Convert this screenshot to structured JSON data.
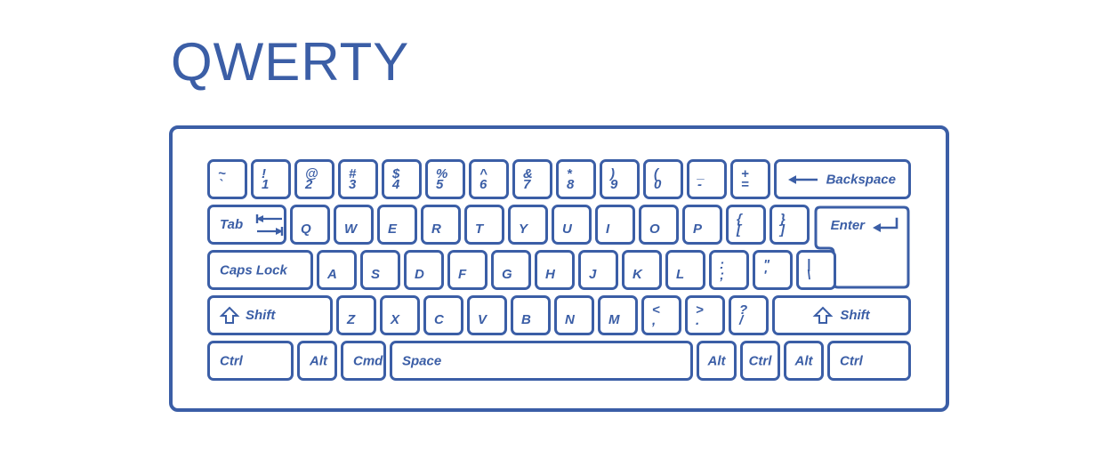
{
  "page": {
    "title": "QWERTY",
    "accent_color": "#3b5ea6",
    "background_color": "#ffffff"
  },
  "keyboard": {
    "layout_name": "QWERTY",
    "rows": [
      {
        "name": "number-row",
        "keys": [
          {
            "name": "backquote",
            "top": "~",
            "bottom": "`"
          },
          {
            "name": "digit-1",
            "top": "!",
            "bottom": "1"
          },
          {
            "name": "digit-2",
            "top": "@",
            "bottom": "2"
          },
          {
            "name": "digit-3",
            "top": "#",
            "bottom": "3"
          },
          {
            "name": "digit-4",
            "top": "$",
            "bottom": "4"
          },
          {
            "name": "digit-5",
            "top": "%",
            "bottom": "5"
          },
          {
            "name": "digit-6",
            "top": "^",
            "bottom": "6"
          },
          {
            "name": "digit-7",
            "top": "&",
            "bottom": "7"
          },
          {
            "name": "digit-8",
            "top": "*",
            "bottom": "8"
          },
          {
            "name": "digit-9",
            "top": ")",
            "bottom": "9"
          },
          {
            "name": "digit-0",
            "top": "(",
            "bottom": "0"
          },
          {
            "name": "minus",
            "top": "_",
            "bottom": "-"
          },
          {
            "name": "equal",
            "top": "+",
            "bottom": "="
          },
          {
            "name": "backspace",
            "label": "Backspace",
            "icon": "arrow-left-icon"
          }
        ]
      },
      {
        "name": "tab-row",
        "keys": [
          {
            "name": "tab",
            "label": "Tab",
            "icon": "tab-arrows-icon"
          },
          {
            "name": "q",
            "label": "Q"
          },
          {
            "name": "w",
            "label": "W"
          },
          {
            "name": "e",
            "label": "E"
          },
          {
            "name": "r",
            "label": "R"
          },
          {
            "name": "t",
            "label": "T"
          },
          {
            "name": "y",
            "label": "Y"
          },
          {
            "name": "u",
            "label": "U"
          },
          {
            "name": "i",
            "label": "I"
          },
          {
            "name": "o",
            "label": "O"
          },
          {
            "name": "p",
            "label": "P"
          },
          {
            "name": "bracket-left",
            "top": "{",
            "bottom": "["
          },
          {
            "name": "bracket-right",
            "top": "}",
            "bottom": "]"
          },
          {
            "name": "enter",
            "label": "Enter",
            "icon": "enter-return-icon"
          }
        ]
      },
      {
        "name": "home-row",
        "keys": [
          {
            "name": "caps-lock",
            "label": "Caps Lock"
          },
          {
            "name": "a",
            "label": "A"
          },
          {
            "name": "s",
            "label": "S"
          },
          {
            "name": "d",
            "label": "D"
          },
          {
            "name": "f",
            "label": "F"
          },
          {
            "name": "g",
            "label": "G"
          },
          {
            "name": "h",
            "label": "H"
          },
          {
            "name": "j",
            "label": "J"
          },
          {
            "name": "k",
            "label": "K"
          },
          {
            "name": "l",
            "label": "L"
          },
          {
            "name": "semicolon",
            "top": ":",
            "bottom": ";"
          },
          {
            "name": "quote",
            "top": "\"",
            "bottom": "'"
          },
          {
            "name": "backslash",
            "top": "|",
            "bottom": "\\"
          }
        ]
      },
      {
        "name": "shift-row",
        "keys": [
          {
            "name": "shift-left",
            "label": "Shift",
            "icon": "shift-arrow-icon"
          },
          {
            "name": "z",
            "label": "Z"
          },
          {
            "name": "x",
            "label": "X"
          },
          {
            "name": "c",
            "label": "C"
          },
          {
            "name": "v",
            "label": "V"
          },
          {
            "name": "b",
            "label": "B"
          },
          {
            "name": "n",
            "label": "N"
          },
          {
            "name": "m",
            "label": "M"
          },
          {
            "name": "comma",
            "top": "<",
            "bottom": ","
          },
          {
            "name": "period",
            "top": ">",
            "bottom": "."
          },
          {
            "name": "slash",
            "top": "?",
            "bottom": "/"
          },
          {
            "name": "shift-right",
            "label": "Shift",
            "icon": "shift-arrow-icon"
          }
        ]
      },
      {
        "name": "bottom-row",
        "keys": [
          {
            "name": "ctrl-left",
            "label": "Ctrl"
          },
          {
            "name": "alt-left",
            "label": "Alt"
          },
          {
            "name": "cmd-left",
            "label": "Cmd"
          },
          {
            "name": "space",
            "label": "Space"
          },
          {
            "name": "alt-right",
            "label": "Alt"
          },
          {
            "name": "ctrl-mid",
            "label": "Ctrl"
          },
          {
            "name": "alt-far-right",
            "label": "Alt"
          },
          {
            "name": "ctrl-right",
            "label": "Ctrl"
          }
        ]
      }
    ]
  }
}
